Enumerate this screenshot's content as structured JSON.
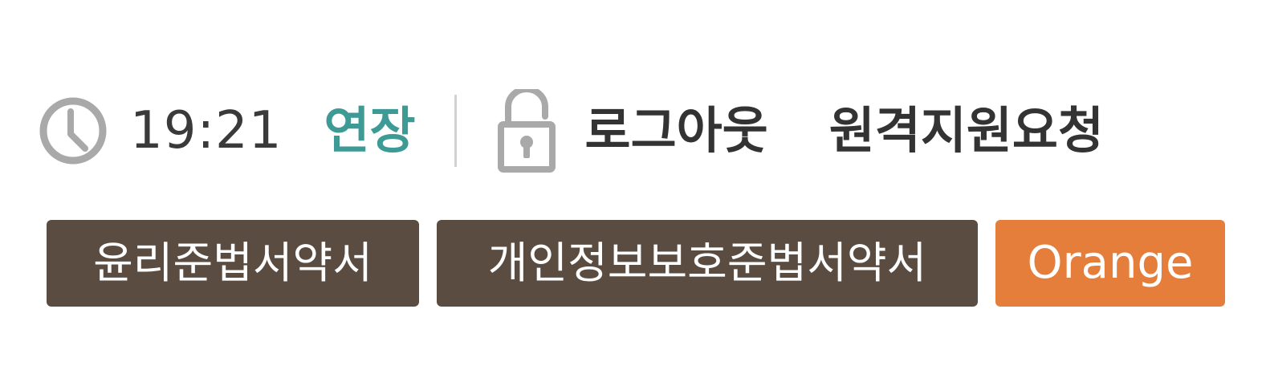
{
  "header": {
    "session": {
      "icon": "clock-icon",
      "time": "19:21",
      "extend_label": "연장"
    },
    "logout": {
      "icon": "lock-icon",
      "label": "로그아웃"
    },
    "remote_support": {
      "label": "원격지원요청"
    }
  },
  "buttons": {
    "ethics_pledge": "윤리준법서약서",
    "privacy_pledge": "개인정보보호준법서약서",
    "orange": "Orange"
  },
  "colors": {
    "accent_teal": "#3d9a94",
    "button_brown": "#5b4c41",
    "button_orange": "#e67e3b",
    "text_dark": "#333333",
    "icon_gray": "#a9a9a9"
  }
}
